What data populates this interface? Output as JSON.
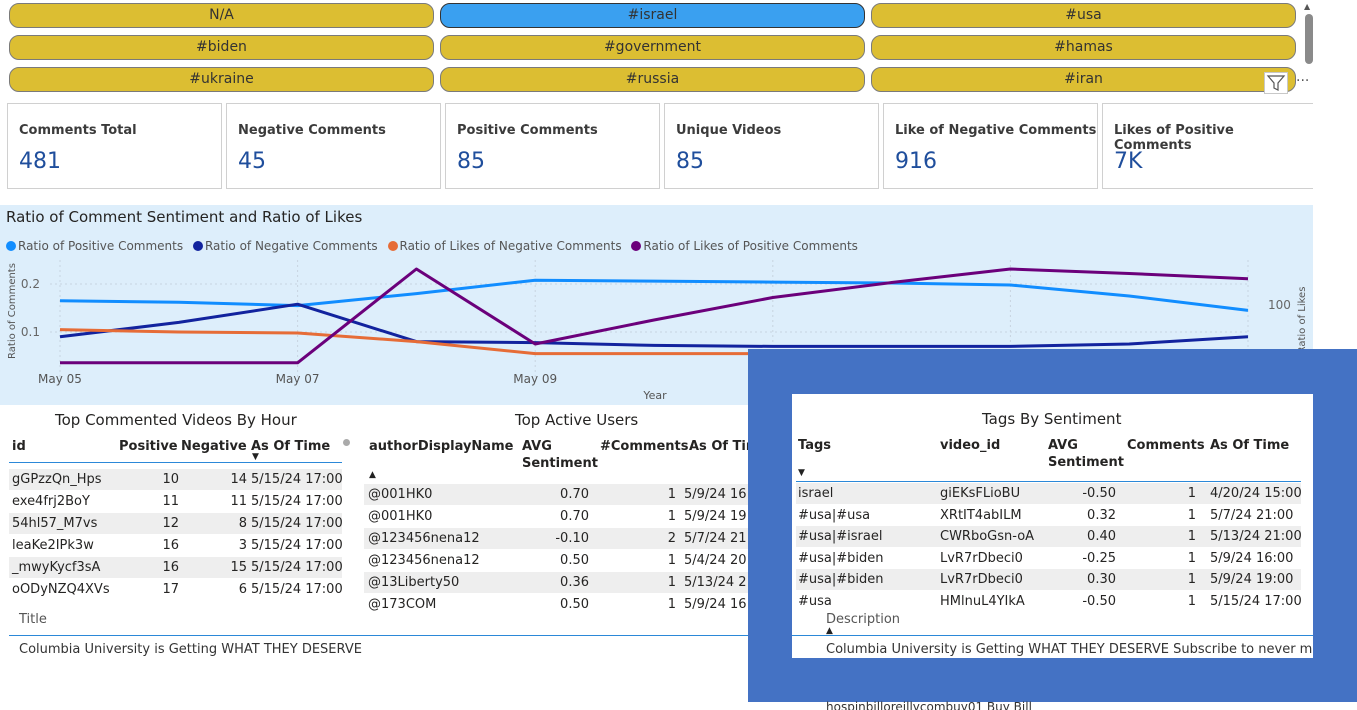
{
  "slicer": {
    "tags": [
      "N/A",
      "#israel",
      "#usa",
      "#biden",
      "#government",
      "#hamas",
      "#ukraine",
      "#russia",
      "#iran"
    ],
    "selected": "#israel",
    "colors": {
      "normal": "#dcbe32",
      "selected": "#3aa0f0"
    }
  },
  "kpis": [
    {
      "label": "Comments Total",
      "value": "481"
    },
    {
      "label": "Negative Comments",
      "value": "45"
    },
    {
      "label": "Positive Comments",
      "value": "85"
    },
    {
      "label": "Unique Videos",
      "value": "85"
    },
    {
      "label": "Like of Negative Comments",
      "value": "916"
    },
    {
      "label": "Likes of Positive Comments",
      "value": "7K"
    }
  ],
  "chart": {
    "title": "Ratio of Comment Sentiment and Ratio of Likes",
    "xlabel": "Year",
    "ylabel_left": "Ratio of Comments",
    "ylabel_right": "Ratio of Likes",
    "yticks_left": [
      "0.2",
      "0.1"
    ],
    "ytick_right": "100",
    "xticks": [
      "May 05",
      "May 07",
      "May 09"
    ]
  },
  "chart_data": {
    "type": "line",
    "x": [
      "May 05",
      "May 06",
      "May 07",
      "May 08",
      "May 09",
      "May 10",
      "May 11",
      "May 12",
      "May 13",
      "May 14",
      "May 15"
    ],
    "series": [
      {
        "name": "Ratio of Positive Comments",
        "axis": "left",
        "color": "#118dff",
        "values": [
          0.165,
          0.162,
          0.155,
          0.18,
          0.208,
          0.206,
          0.204,
          0.202,
          0.198,
          0.175,
          0.145
        ]
      },
      {
        "name": "Ratio of Negative Comments",
        "axis": "left",
        "color": "#12239e",
        "values": [
          0.09,
          0.12,
          0.158,
          0.08,
          0.078,
          0.072,
          0.07,
          0.07,
          0.07,
          0.075,
          0.09
        ]
      },
      {
        "name": "Ratio of Likes of Negative Comments",
        "axis": "left",
        "color": "#e66c37",
        "values": [
          0.105,
          0.1,
          0.098,
          0.08,
          0.055,
          0.055,
          0.055,
          0.055,
          0.055,
          0.055,
          0.055
        ]
      },
      {
        "name": "Ratio of Likes of Positive Comments",
        "axis": "right",
        "color": "#6b007b",
        "values": [
          23,
          23,
          23,
          148,
          48,
          80,
          110,
          130,
          148,
          142,
          135
        ]
      }
    ],
    "ylim_left": [
      0,
      0.25
    ],
    "ylim_right": [
      0,
      160
    ],
    "legend": "top-left"
  },
  "videos_table": {
    "title": "Top Commented Videos By Hour",
    "headers": [
      "id",
      "Positive",
      "Negative",
      "As Of Time"
    ],
    "rows": [
      [
        "gGPzzQn_Hps",
        "10",
        "14",
        "5/15/24 17:00"
      ],
      [
        "exe4frj2BoY",
        "11",
        "11",
        "5/15/24 17:00"
      ],
      [
        "54hl57_M7vs",
        "12",
        "8",
        "5/15/24 17:00"
      ],
      [
        "leaKe2IPk3w",
        "16",
        "3",
        "5/15/24 17:00"
      ],
      [
        "_mwyKycf3sA",
        "16",
        "15",
        "5/15/24 17:00"
      ],
      [
        "oODyNZQ4XVs",
        "17",
        "6",
        "5/15/24 17:00"
      ]
    ],
    "detail_label": "Title",
    "detail_value": "Columbia University is Getting WHAT THEY DESERVE"
  },
  "users_table": {
    "title": "Top Active Users",
    "headers": [
      "authorDisplayName",
      "AVG Sentiment",
      "#Comments",
      "As Of Tim"
    ],
    "rows": [
      [
        "@001HK0",
        "0.70",
        "1",
        "5/9/24 16"
      ],
      [
        "@001HK0",
        "0.70",
        "1",
        "5/9/24 19"
      ],
      [
        "@123456nena12",
        "-0.10",
        "2",
        "5/7/24 21"
      ],
      [
        "@123456nena12",
        "0.50",
        "1",
        "5/4/24 20"
      ],
      [
        "@13Liberty50",
        "0.36",
        "1",
        "5/13/24 2"
      ],
      [
        "@173COM",
        "0.50",
        "1",
        "5/9/24 16"
      ]
    ]
  },
  "tags_table": {
    "title": "Tags By Sentiment",
    "headers": [
      "Tags",
      "video_id",
      "AVG Sentiment",
      "Comments",
      "As Of Time"
    ],
    "rows": [
      [
        "israel",
        "giEKsFLioBU",
        "-0.50",
        "1",
        "4/20/24 15:00"
      ],
      [
        "#usa|#usa",
        "XRtIT4abILM",
        "0.32",
        "1",
        "5/7/24 21:00"
      ],
      [
        "#usa|#israel",
        "CWRboGsn-oA",
        "0.40",
        "1",
        "5/13/24 21:00"
      ],
      [
        "#usa|#biden",
        "LvR7rDbeci0",
        "-0.25",
        "1",
        "5/9/24 16:00"
      ],
      [
        "#usa|#biden",
        "LvR7rDbeci0",
        "0.30",
        "1",
        "5/9/24 19:00"
      ],
      [
        "#usa",
        "HMlnuL4YIkA",
        "-0.50",
        "1",
        "5/15/24 17:00"
      ]
    ],
    "detail_label": "Description",
    "detail_value": "Columbia University is Getting WHAT THEY DESERVE Subscribe to never miss ar"
  },
  "hidden_text": "hospinbilloreillycombuy01 Buy Bill"
}
